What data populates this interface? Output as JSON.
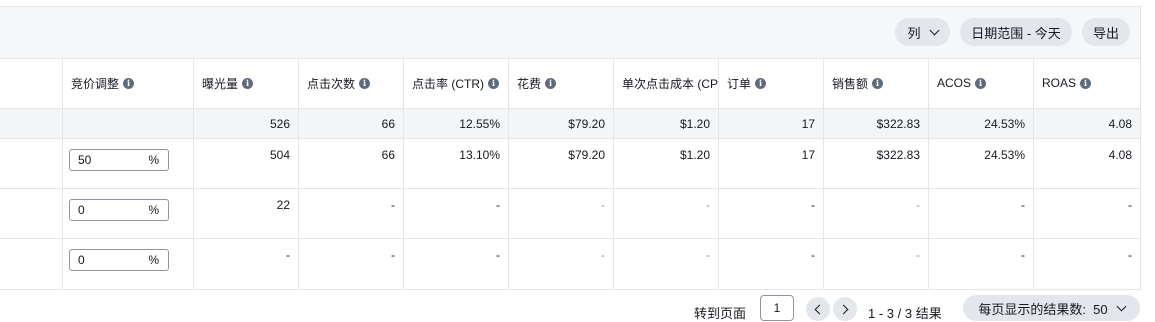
{
  "toolbar": {
    "columns_label": "列",
    "date_range_label": "日期范围 - 今天",
    "export_label": "导出"
  },
  "columns": [
    {
      "key": "bid_adjust",
      "label": "竞价调整"
    },
    {
      "key": "impressions",
      "label": "曝光量"
    },
    {
      "key": "clicks",
      "label": "点击次数"
    },
    {
      "key": "ctr",
      "label": "点击率 (CTR)"
    },
    {
      "key": "spend",
      "label": "花费"
    },
    {
      "key": "cpc",
      "label": "单次点击成本 (CPC)"
    },
    {
      "key": "orders",
      "label": "订单"
    },
    {
      "key": "sales",
      "label": "销售额"
    },
    {
      "key": "acos",
      "label": "ACOS"
    },
    {
      "key": "roas",
      "label": "ROAS"
    }
  ],
  "summary": [
    "",
    "526",
    "66",
    "12.55%",
    "$79.20",
    "$1.20",
    "17",
    "$322.83",
    "24.53%",
    "4.08"
  ],
  "rows": [
    {
      "bid_value": "50",
      "bid_unit": "%",
      "cells": [
        "504",
        "66",
        "13.10%",
        "$79.20",
        "$1.20",
        "17",
        "$322.83",
        "24.53%",
        "4.08"
      ]
    },
    {
      "bid_value": "0",
      "bid_unit": "%",
      "cells": [
        "22",
        "-",
        "-",
        "-",
        "-",
        "-",
        "-",
        "-",
        "-"
      ]
    },
    {
      "bid_value": "0",
      "bid_unit": "%",
      "cells": [
        "-",
        "-",
        "-",
        "-",
        "-",
        "-",
        "-",
        "-",
        "-"
      ]
    }
  ],
  "pagination": {
    "goto_label": "转到页面",
    "current_page": "1",
    "results_text": "1 - 3 / 3 结果",
    "per_page_label": "每页显示的结果数:  50"
  }
}
